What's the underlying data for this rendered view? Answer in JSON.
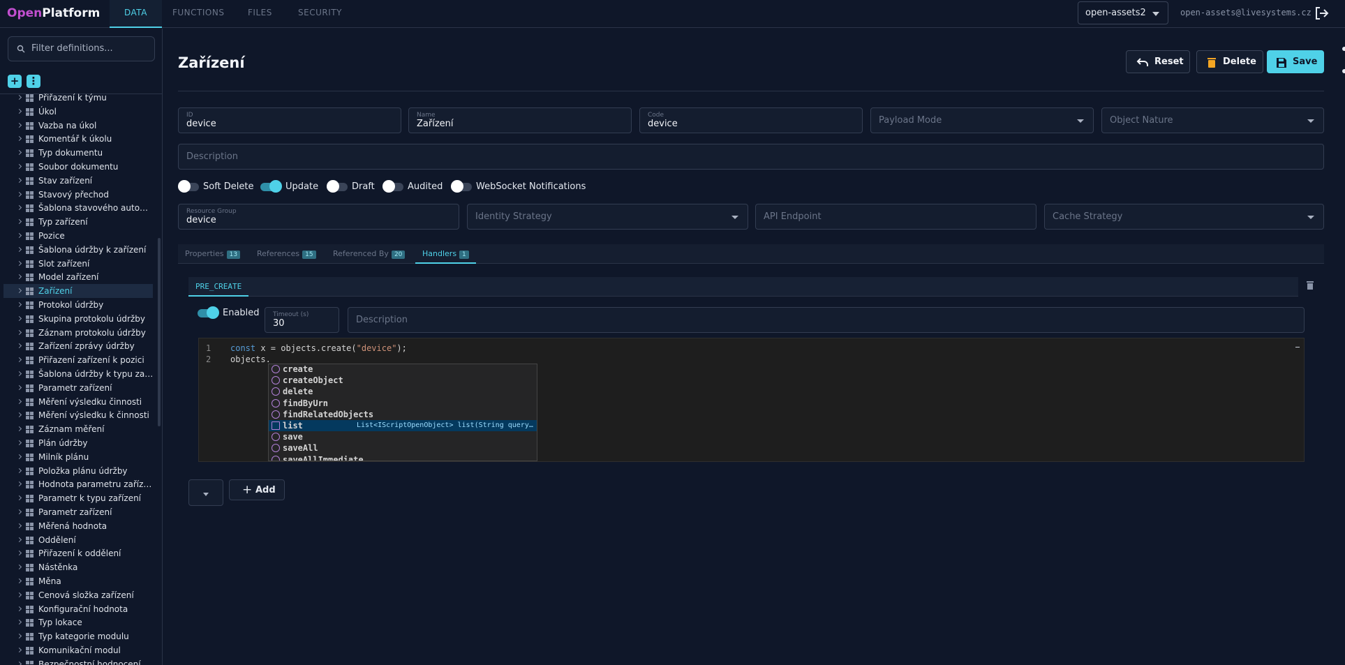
{
  "app": {
    "logo_open": "Open",
    "logo_platform": "Platform",
    "nav_tabs": [
      "DATA",
      "FUNCTIONS",
      "FILES",
      "SECURITY"
    ],
    "project": "open-assets2",
    "user_email": "open-assets@livesystems.cz"
  },
  "sidebar": {
    "filter_placeholder": "Filter definitions...",
    "add_label": "+",
    "more_label": "⋮",
    "items": [
      "Přiřazení k týmu",
      "Úkol",
      "Vazba na úkol",
      "Komentář k úkolu",
      "Typ dokumentu",
      "Soubor dokumentu",
      "Stav zařízení",
      "Stavový přechod",
      "Šablona stavového automatu",
      "Typ zařízení",
      "Pozice",
      "Šablona údržby k zařízení",
      "Slot zařízení",
      "Model zařízení",
      "Zařízení",
      "Protokol údržby",
      "Skupina protokolu údržby",
      "Záznam protokolu údržby",
      "Zařízení zprávy údržby",
      "Přiřazení zařízení k pozici",
      "Šablona údržby k typu zařízení",
      "Parametr zařízení",
      "Měření výsledku činnosti",
      "Měření výsledku k činnosti",
      "Záznam měření",
      "Plán údržby",
      "Milník plánu",
      "Položka plánu údržby",
      "Hodnota parametru zařízení",
      "Parametr k typu zařízení",
      "Parametr zařízení",
      "Měřená hodnota",
      "Oddělení",
      "Přiřazení k oddělení",
      "Nástěnka",
      "Měna",
      "Cenová složka zařízení",
      "Konfigurační hodnota",
      "Typ lokace",
      "Typ kategorie modulu",
      "Komunikační modul",
      "Bezpečnostní hodnocení"
    ],
    "selected_index": 14
  },
  "main": {
    "title": "Zařízení",
    "buttons": {
      "reset": "Reset",
      "delete": "Delete",
      "save": "Save"
    },
    "fields": {
      "id": {
        "label": "ID",
        "value": "device"
      },
      "name": {
        "label": "Name",
        "value": "Zařízení"
      },
      "code": {
        "label": "Code",
        "value": "device"
      },
      "payload_mode": {
        "placeholder": "Payload Mode"
      },
      "object_nature": {
        "placeholder": "Object Nature"
      },
      "description": {
        "placeholder": "Description"
      },
      "resource_group": {
        "label": "Resource Group",
        "value": "device"
      },
      "identity_strategy": {
        "placeholder": "Identity Strategy"
      },
      "api_endpoint": {
        "placeholder": "API Endpoint"
      },
      "cache_strategy": {
        "placeholder": "Cache Strategy"
      }
    },
    "toggles": [
      {
        "label": "Soft Delete",
        "on": false
      },
      {
        "label": "Update",
        "on": true
      },
      {
        "label": "Draft",
        "on": false
      },
      {
        "label": "Audited",
        "on": false
      },
      {
        "label": "WebSocket Notifications",
        "on": false
      }
    ],
    "tabs": [
      {
        "label": "Properties",
        "count": "13"
      },
      {
        "label": "References",
        "count": "15"
      },
      {
        "label": "Referenced By",
        "count": "20"
      },
      {
        "label": "Handlers",
        "count": "1"
      }
    ],
    "active_tab": 3
  },
  "handler": {
    "tab": "PRE_CREATE",
    "enabled_label": "Enabled",
    "enabled": true,
    "timeout_label": "Timeout (s)",
    "timeout_value": "30",
    "description_placeholder": "Description",
    "code_lines": [
      {
        "num": "1",
        "parts": [
          [
            "kw",
            "const"
          ],
          [
            "tx",
            " x = objects.create("
          ],
          [
            "st",
            "\"device\""
          ],
          [
            "tx",
            ");"
          ]
        ]
      },
      {
        "num": "2",
        "parts": [
          [
            "tx",
            "objects."
          ]
        ]
      }
    ],
    "suggestions": [
      {
        "name": "create",
        "detail": ""
      },
      {
        "name": "createObject",
        "detail": ""
      },
      {
        "name": "delete",
        "detail": ""
      },
      {
        "name": "findByUrn",
        "detail": ""
      },
      {
        "name": "findRelatedObjects",
        "detail": ""
      },
      {
        "name": "list",
        "detail": "List<IScriptOpenObject> list(String query…"
      },
      {
        "name": "save",
        "detail": ""
      },
      {
        "name": "saveAll",
        "detail": ""
      },
      {
        "name": "saveAllImmediate",
        "detail": ""
      }
    ],
    "selected_suggestion": 5,
    "add_label": "Add"
  },
  "colors": {
    "accent": "#4fd1e8",
    "brand_open": "#c24fd0",
    "background": "#0f1729"
  }
}
